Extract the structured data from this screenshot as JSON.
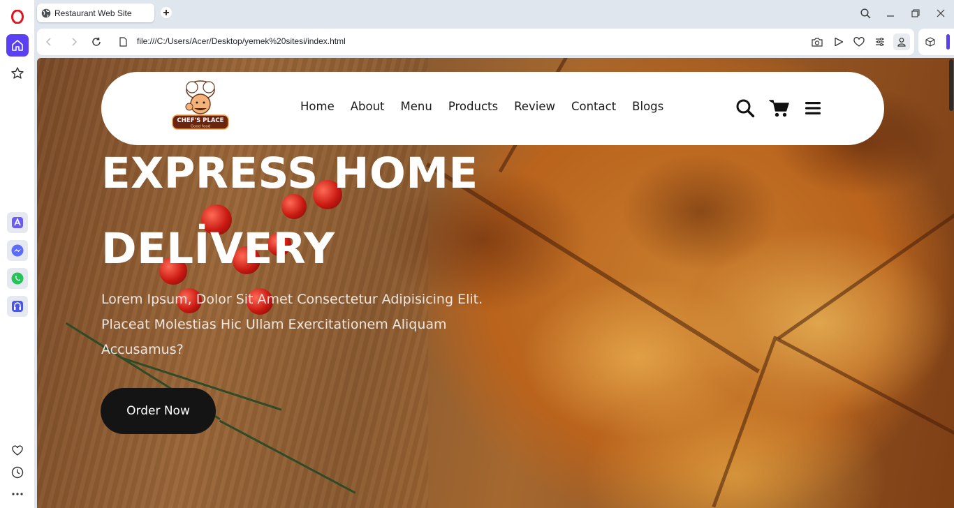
{
  "browser": {
    "tab": {
      "title": "Restaurant Web Site"
    },
    "address": {
      "url": "file:///C:/Users/Acer/Desktop/yemek%20sitesi/index.html"
    },
    "accent_color": "#5a3ff5"
  },
  "sidebar": {
    "items": [
      "opera-logo",
      "home",
      "speed-dial",
      "aria",
      "messenger",
      "whatsapp",
      "music-player",
      "my-flow",
      "history",
      "more"
    ]
  },
  "site": {
    "logo": {
      "line1": "CHEF'S PLACE",
      "line2": "Good food"
    },
    "nav": [
      "Home",
      "About",
      "Menu",
      "Products",
      "Review",
      "Contact",
      "Blogs"
    ],
    "hero": {
      "title_line1": "EXPRESS HOME",
      "title_line2": "DELİVERY",
      "text": "Lorem Ipsum, Dolor Sit Amet Consectetur Adipisicing Elit. Placeat Molestias Hic Ullam Exercitationem Aliquam Accusamus?",
      "button": "Order Now"
    }
  }
}
